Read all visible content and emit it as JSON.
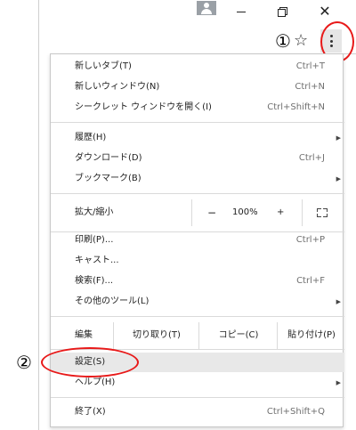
{
  "window": {
    "minimize_icon": "minimize-icon",
    "restore_icon": "restore-icon",
    "close_glyph": "✕"
  },
  "toolbar": {
    "marker_1": "①",
    "star_glyph": "☆"
  },
  "menu": {
    "group1": [
      {
        "label": "新しいタブ(T)",
        "shortcut": "Ctrl+T"
      },
      {
        "label": "新しいウィンドウ(N)",
        "shortcut": "Ctrl+N"
      },
      {
        "label": "シークレット ウィンドウを開く(I)",
        "shortcut": "Ctrl+Shift+N"
      }
    ],
    "group2": [
      {
        "label": "履歴(H)",
        "shortcut": ""
      },
      {
        "label": "ダウンロード(D)",
        "shortcut": "Ctrl+J"
      },
      {
        "label": "ブックマーク(B)",
        "shortcut": ""
      }
    ],
    "zoom": {
      "label": "拡大/縮小",
      "minus": "−",
      "value": "100%",
      "plus": "+"
    },
    "group3": [
      {
        "label": "印刷(P)...",
        "shortcut": "Ctrl+P"
      },
      {
        "label": "キャスト...",
        "shortcut": ""
      },
      {
        "label": "検索(F)...",
        "shortcut": "Ctrl+F"
      },
      {
        "label": "その他のツール(L)",
        "shortcut": ""
      }
    ],
    "edit": {
      "label": "編集",
      "cut": "切り取り(T)",
      "copy": "コピー(C)",
      "paste": "貼り付け(P)"
    },
    "group4": [
      {
        "label": "設定(S)",
        "shortcut": ""
      },
      {
        "label": "ヘルプ(H)",
        "shortcut": ""
      }
    ],
    "exit": {
      "label": "終了(X)",
      "shortcut": "Ctrl+Shift+Q"
    },
    "submenu_arrow": "▶"
  },
  "annotations": {
    "marker_2": "②",
    "highlight_color": "#e81919"
  }
}
